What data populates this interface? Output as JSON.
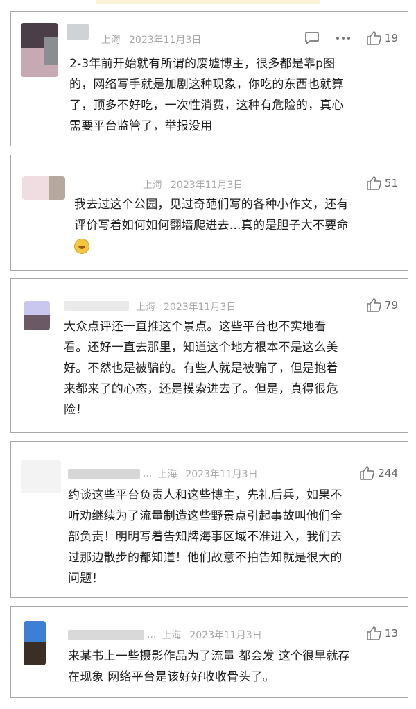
{
  "colors": {
    "card_border": "#a8a8a8",
    "meta_text": "#a8a8a8",
    "body_text": "#1e1e1e"
  },
  "comments": [
    {
      "location": "上海",
      "date": "2023年11月3日",
      "likes": "19",
      "icons": [
        "reply-icon",
        "more-icon",
        "thumbs-up-icon"
      ],
      "lines": [
        "2-3年前开始就有所谓的废墟博主，很多都是靠p图",
        "的，网络写手就是加剧这种现象，你吃的东西也就算",
        "了，顶多不好吃，一次性消费，这种有危险的，真心",
        "需要平台监管了，举报没用"
      ]
    },
    {
      "location": "上海",
      "date": "2023年11月3日",
      "likes": "51",
      "lines": [
        "我去过这个公园，见过奇葩们写的各种小作文，还有",
        "评价写着如何如何翻墙爬进去…真的是胆子大不要命"
      ],
      "emoji": "laughing-emoji"
    },
    {
      "location": "上海",
      "date": "2023年11月3日",
      "likes": "79",
      "lines": [
        "大众点评还一直推这个景点。这些平台也不实地看",
        "看。还好一直去那里，知道这个地方根本不是这么美",
        "好。不然也是被骗的。有些人就是被骗了，但是抱着",
        "来都来了的心态，还是摸索进去了。但是，真得很危",
        "险！"
      ]
    },
    {
      "name_suffix": "...",
      "location": "上海",
      "date": "2023年11月3日",
      "likes": "244",
      "lines": [
        "约谈这些平台负责人和这些博主，先礼后兵，如果不",
        "听劝继续为了流量制造这些野景点引起事故叫他们全",
        "部负责！明明写着告知牌海事区域不准进入，我们去",
        "过那边散步的都知道！他们故意不拍告知就是很大的",
        "问题！"
      ]
    },
    {
      "name_suffix": "...",
      "location": "上海",
      "date": "2023年11月3日",
      "likes": "13",
      "lines": [
        "来某书上一些摄影作品为了流量 都会发 这个很早就存",
        "在现象 网络平台是该好好收收骨头了。"
      ]
    }
  ]
}
